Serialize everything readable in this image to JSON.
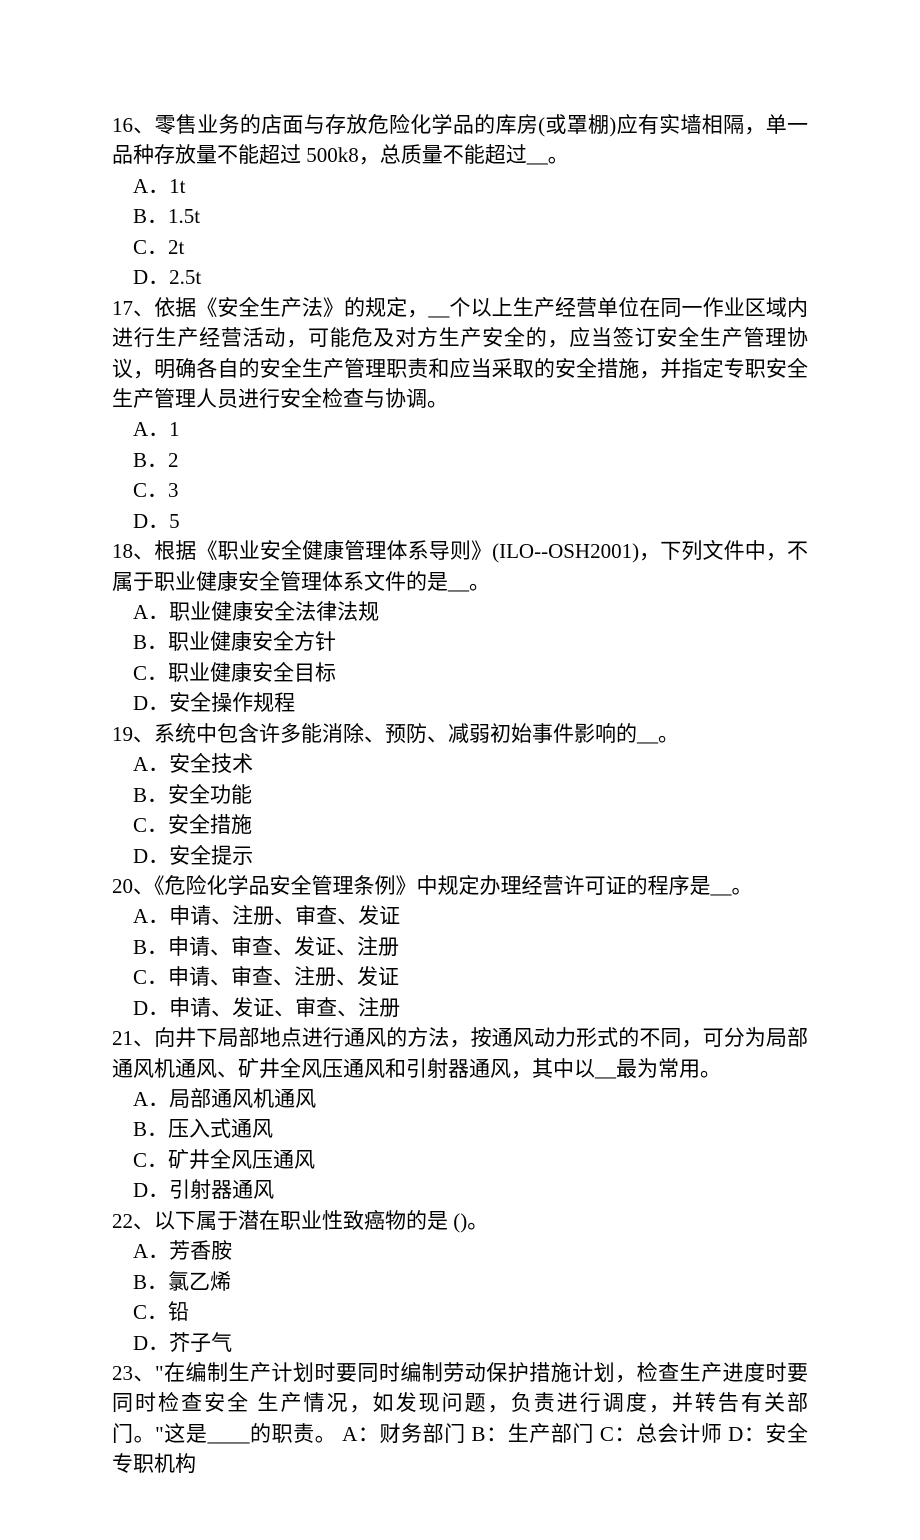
{
  "questions": [
    {
      "num": "16",
      "stem": "零售业务的店面与存放危险化学品的库房(或罩棚)应有实墙相隔，单一品种存放量不能超过 500k8，总质量不能超过__。",
      "options": [
        "A．1t",
        "B．1.5t",
        "C．2t",
        "D．2.5t"
      ]
    },
    {
      "num": "17",
      "stem": "依据《安全生产法》的规定，__个以上生产经营单位在同一作业区域内进行生产经营活动，可能危及对方生产安全的，应当签订安全生产管理协议，明确各自的安全生产管理职责和应当采取的安全措施，并指定专职安全生产管理人员进行安全检查与协调。",
      "options": [
        "A．1",
        "B．2",
        "C．3",
        "D．5"
      ]
    },
    {
      "num": "18",
      "stem": "根据《职业安全健康管理体系导则》(ILO--OSH2001)，下列文件中，不属于职业健康安全管理体系文件的是__。",
      "options": [
        "A．职业健康安全法律法规",
        "B．职业健康安全方针",
        "C．职业健康安全目标",
        "D．安全操作规程"
      ]
    },
    {
      "num": "19",
      "stem": "系统中包含许多能消除、预防、减弱初始事件影响的__。",
      "options": [
        "A．安全技术",
        "B．安全功能",
        "C．安全措施",
        "D．安全提示"
      ]
    },
    {
      "num": "20",
      "stem": "《危险化学品安全管理条例》中规定办理经营许可证的程序是__。",
      "options": [
        "A．申请、注册、审查、发证",
        "B．申请、审查、发证、注册",
        "C．申请、审查、注册、发证",
        "D．申请、发证、审查、注册"
      ]
    },
    {
      "num": "21",
      "stem": "向井下局部地点进行通风的方法，按通风动力形式的不同，可分为局部通风机通风、矿井全风压通风和引射器通风，其中以__最为常用。",
      "options": [
        "A．局部通风机通风",
        "B．压入式通风",
        "C．矿井全风压通风",
        "D．引射器通风"
      ]
    },
    {
      "num": "22",
      "stem": "以下属于潜在职业性致癌物的是 ()。",
      "options": [
        "A．芳香胺",
        "B．氯乙烯",
        "C．铅",
        "D．芥子气"
      ]
    },
    {
      "num": "23",
      "stem": "\"在编制生产计划时要同时编制劳动保护措施计划，检查生产进度时要同时检查安全 生产情况，如发现问题，负责进行调度，并转告有关部门。\"这是____的职责。   A：财务部门 B：生产部门 C：总会计师 D：安全专职机构",
      "options": []
    }
  ]
}
